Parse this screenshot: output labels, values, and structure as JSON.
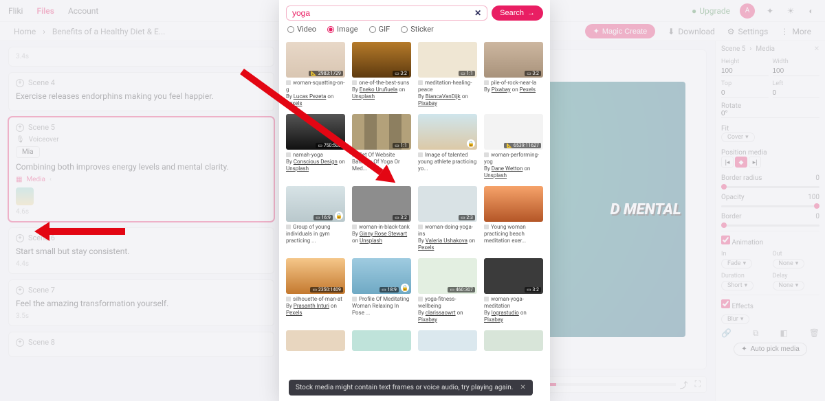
{
  "topnav": {
    "brand": "Fliki",
    "files": "Files",
    "account": "Account",
    "upgrade": "Upgrade"
  },
  "breadcrumb": {
    "home": "Home",
    "project": "Benefits of a Healthy Diet & E...",
    "magic": "Magic Create",
    "download": "Download",
    "settings": "Settings",
    "more": "More"
  },
  "scenes": {
    "s0_meta": "3.4s",
    "s4_title": "Scene 4",
    "s4_text": "Exercise releases endorphins making you feel happier.",
    "s5_title": "Scene 5",
    "s5_voiceover": "Voiceover",
    "s5_voice": "Mia",
    "s5_text": "Combining both improves energy levels and mental clarity.",
    "s5_media": "Media",
    "s5_meta": "4.6s",
    "s6_title": "Scene 6",
    "s6_text": "Start small but stay consistent.",
    "s6_meta": "4.4s",
    "s7_title": "Scene 7",
    "s7_text": "Feel the amazing transformation yourself.",
    "s7_meta": "3.5s",
    "s8_title": "Scene 8"
  },
  "preview": {
    "text": "D MENTAL"
  },
  "panel": {
    "header_scene": "Scene 5",
    "header_media": "Media",
    "height": "Height",
    "height_v": "100",
    "width": "Width",
    "width_v": "100",
    "top": "Top",
    "top_v": "0",
    "left": "Left",
    "left_v": "0",
    "rotate": "Rotate",
    "rotate_v": "0°",
    "fit": "Fit",
    "fit_v": "Cover",
    "posmedia": "Position media",
    "bradius": "Border radius",
    "bradius_v": "0",
    "opacity": "Opacity",
    "opacity_v": "100",
    "border": "Border",
    "border_v": "0",
    "anim": "Animation",
    "in": "In",
    "in_v": "Fade",
    "out": "Out",
    "out_v": "None",
    "dur": "Duration",
    "dur_v": "Short",
    "delay": "Delay",
    "delay_v": "None",
    "effects": "Effects",
    "effects_v": "Blur",
    "autopick": "Auto pick media"
  },
  "search": {
    "value": "yoga",
    "button": "Search",
    "tabs": {
      "video": "Video",
      "image": "Image",
      "gif": "GIF",
      "sticker": "Sticker"
    }
  },
  "results": {
    "r1": [
      {
        "title": "woman-squatting-on-g",
        "by": "By ",
        "author": "Lucas Pezeta",
        "on": " on ",
        "src": "Pexels",
        "badge": "📐 2983:1729"
      },
      {
        "title": "one-of-the-best-suns",
        "by": "By ",
        "author": "Eneko Uruñuela",
        "on": " on ",
        "src": "Unsplash",
        "badge": "▭ 3:2"
      },
      {
        "title": "meditation-healing-peace",
        "by": "By ",
        "author": "BiancaVanDijk",
        "on": " on ",
        "src": "Pixabay",
        "badge": "▭ 1:1"
      },
      {
        "title": "pile-of-rock-near-la",
        "by": "By ",
        "author": "Pixabay",
        "on": " on ",
        "src": "Pexels",
        "badge": "▭ 3:2"
      }
    ],
    "r2": [
      {
        "title": "namah-yoga",
        "by": "By ",
        "author": "Conscious Design",
        "on": " on ",
        "src": "Unsplash",
        "badge": "▭ 750:503"
      },
      {
        "title": "Set Of Website Banners Of Yoga Or Med...",
        "badge": "▭ 1:1",
        "lock": true
      },
      {
        "title": "Image of talented young athlete practicing yo...",
        "badge": "",
        "lock": true
      },
      {
        "title": "woman-performing-yog",
        "by": "By ",
        "author": "Dane Wetton",
        "on": " on ",
        "src": "Unsplash",
        "badge": "📐 6539:11627"
      }
    ],
    "r3": [
      {
        "title": "Group of young individuals in gym practicing ...",
        "badge": "▭ 16:9",
        "lock": true
      },
      {
        "title": "woman-in-black-tank",
        "by": "By ",
        "author": "Ginny Rose Stewart",
        "on": " on ",
        "src": "Unsplash",
        "badge": "▭ 3:2"
      },
      {
        "title": "woman-doing-yoga-ins",
        "by": "By ",
        "author": "Valeria Ushakova",
        "on": " on ",
        "src": "Pexels",
        "badge": "▭ 2:3"
      },
      {
        "title": "Young woman practicing beach meditation exer...",
        "badge": ""
      }
    ],
    "r4": [
      {
        "title": "silhouette-of-man-at",
        "by": "By ",
        "author": "Prasanth Inturi",
        "on": " on ",
        "src": "Pexels",
        "badge": "▭ 2350:1409"
      },
      {
        "title": "Profile Of Meditating Woman Relaxing In Pose ...",
        "badge": "▭ 18:9",
        "lock": true
      },
      {
        "title": "yoga-fitness-wellbeing",
        "by": "By ",
        "author": "clarissaowrt",
        "on": " on ",
        "src": "Pixabay",
        "badge": "▭ 460:307"
      },
      {
        "title": "woman-yoga-meditation",
        "by": "By ",
        "author": "lograstudio",
        "on": " on ",
        "src": "Pixabay",
        "badge": "▭ 3:2"
      }
    ]
  },
  "snack": "Stock media might contain text frames or voice audio, try playing again."
}
